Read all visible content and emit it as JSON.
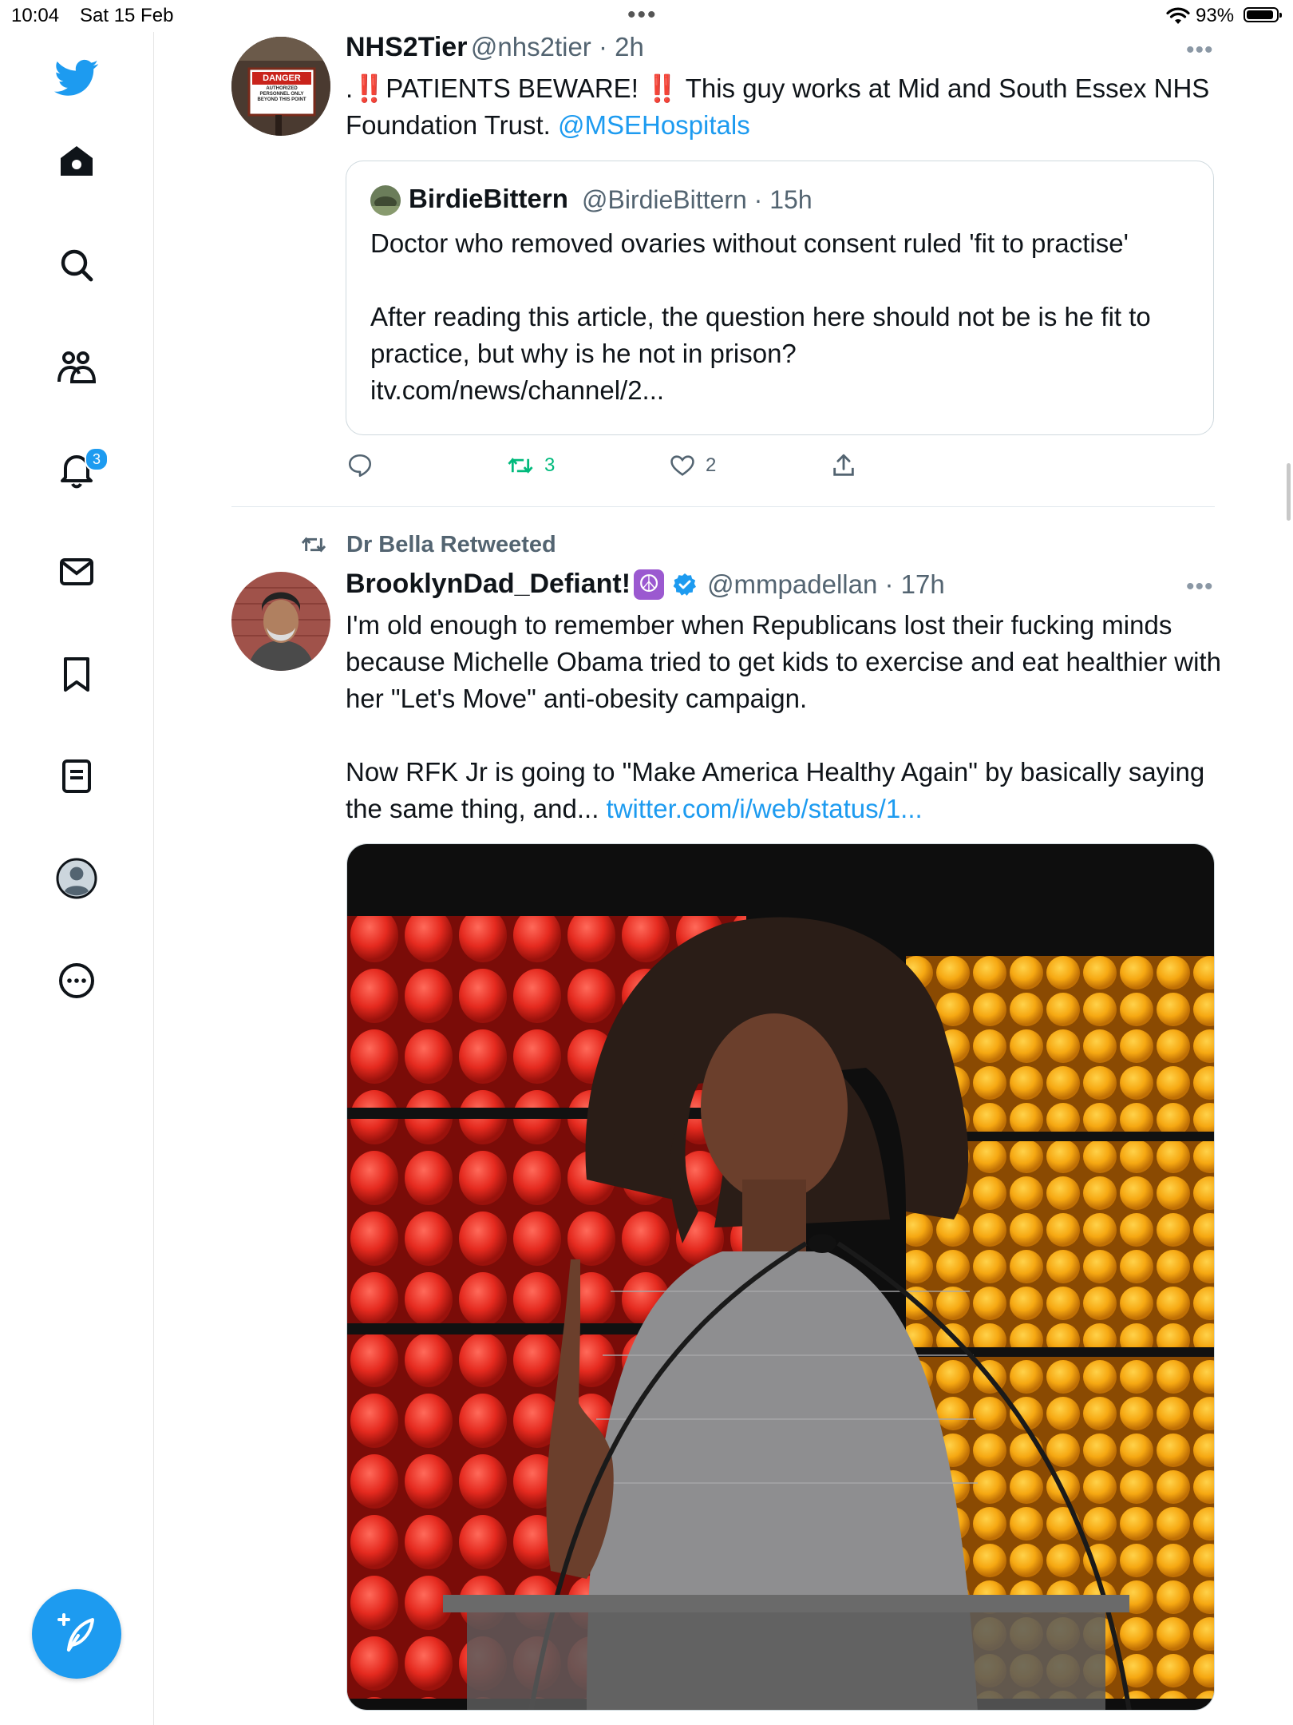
{
  "status": {
    "time": "10:04",
    "date": "Sat 15 Feb",
    "battery": "93%",
    "dots": "•••"
  },
  "sidebar": {
    "items": [
      {
        "label": "Twitter",
        "icon": "twitter-bird-icon"
      },
      {
        "label": "Home",
        "icon": "home-icon"
      },
      {
        "label": "Search",
        "icon": "search-icon"
      },
      {
        "label": "Communities",
        "icon": "communities-icon"
      },
      {
        "label": "Notifications",
        "icon": "bell-icon"
      },
      {
        "label": "Messages",
        "icon": "envelope-icon"
      },
      {
        "label": "Bookmarks",
        "icon": "bookmark-icon"
      },
      {
        "label": "Lists",
        "icon": "lists-icon"
      },
      {
        "label": "Profile",
        "icon": "profile-icon"
      },
      {
        "label": "More",
        "icon": "more-circle-icon"
      }
    ],
    "notification_badge": "3",
    "compose_icon": "compose-tweet-icon"
  },
  "tweet1": {
    "name": "NHS2Tier",
    "handle_time": "@nhs2tier · 2h",
    "more": "•••",
    "text_prefix": ".",
    "text_excl1": "‼️",
    "text_mid": "PATIENTS BEWARE!",
    "text_excl2": "‼️",
    "text_rest": " This guy works at Mid and South Essex NHS Foundation Trust. ",
    "mention": "@MSEHospitals",
    "avatar_sign": {
      "title": "DANGER",
      "line1": "AUTHORIZED",
      "line2": "PERSONNEL ONLY",
      "line3": "BEYOND THIS POINT"
    },
    "quote": {
      "name": "BirdieBittern",
      "handle_time": "@BirdieBittern · 15h",
      "line1": "Doctor who removed ovaries without consent ruled 'fit to practise'",
      "line2": "After reading this article, the question here should not be is he fit to practice, but why is he not in prison?",
      "line3": "itv.com/news/channel/2..."
    },
    "actions": {
      "reply_count": "",
      "retweet_count": "3",
      "like_count": "2"
    },
    "colors": {
      "retweet": "#00ba7c"
    }
  },
  "tweet2": {
    "retweeted_by": "Dr Bella Retweeted",
    "name": "BrooklynDad_Defiant!",
    "name_emoji": "☮️",
    "verified": true,
    "handle_time": "@mmpadellan · 17h",
    "more": "•••",
    "para1": "I'm old enough to remember when Republicans lost their fucking minds because Michelle Obama tried to get kids to exercise and eat healthier with her \"Let's Move\" anti-obesity campaign.",
    "para2": "Now RFK Jr is going to \"Make America Healthy Again\" by basically saying the same thing, and... ",
    "link": "twitter.com/i/web/status/1..."
  },
  "theme": {
    "accent": "#1d9bf0",
    "text": "#0f1419",
    "secondary": "#536471"
  }
}
